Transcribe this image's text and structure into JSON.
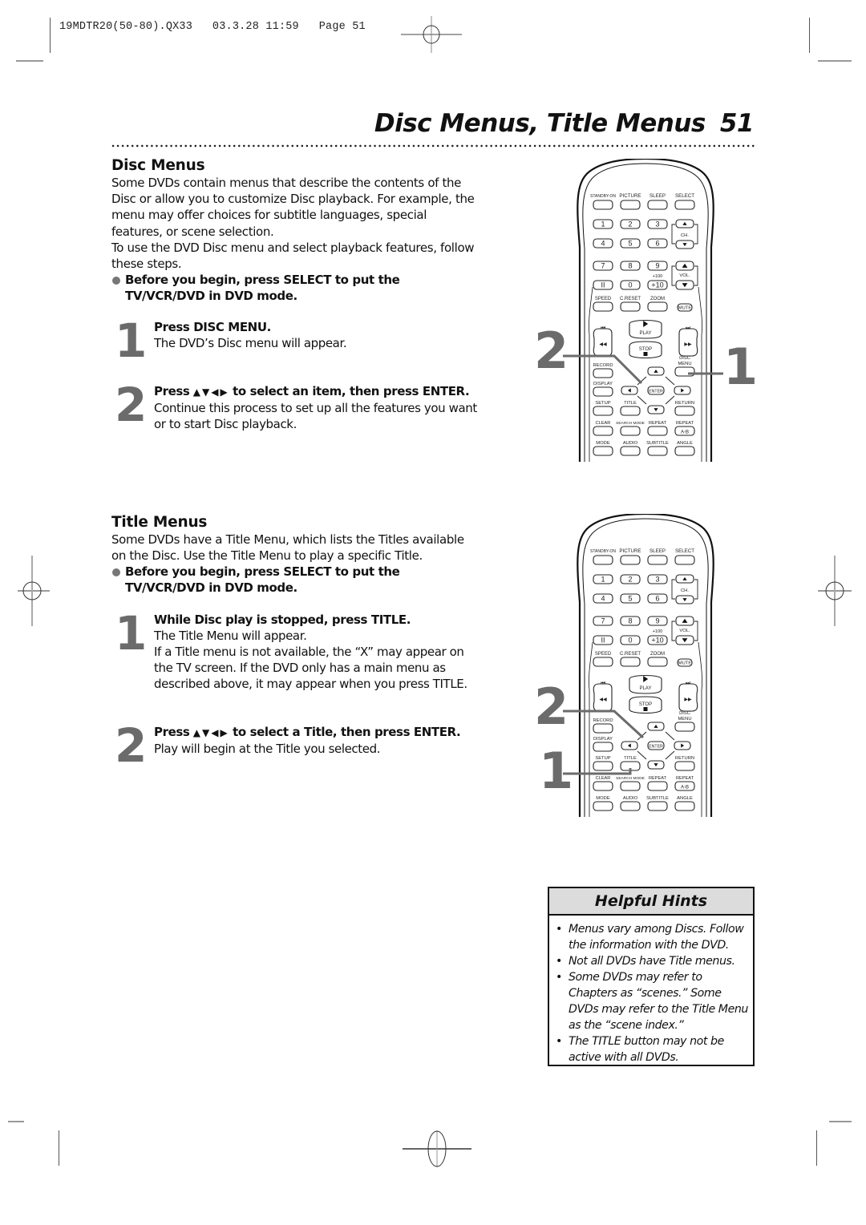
{
  "slug": "19MDTR20(50-80).QX33   03.3.28 11:59   Page 51",
  "header": {
    "title": "Disc Menus, Title Menus",
    "page_number": "51"
  },
  "disc_menus": {
    "heading": "Disc Menus",
    "intro": "Some DVDs contain menus that describe the contents of the Disc or allow you to customize Disc playback.  For example, the menu may offer choices for subtitle languages, special features, or scene selection.",
    "intro2": "To use the DVD Disc menu and select playback features, follow these steps.",
    "bullet": "Before you begin, press SELECT to put the TV/VCR/DVD in DVD mode.",
    "steps": [
      {
        "number": "1",
        "bold": "Press DISC MENU.",
        "text": "The DVD’s Disc menu will appear."
      },
      {
        "number": "2",
        "bold_pre": "Press",
        "arrows": "▲▼◀▶",
        "bold_post": "to select an item, then press ENTER.",
        "text": "Continue this process to set up all the features you want or to start Disc playback."
      }
    ]
  },
  "title_menus": {
    "heading": "Title Menus",
    "intro": "Some DVDs have a Title Menu, which lists the Titles available on the Disc.  Use the Title Menu to play a specific Title.",
    "bullet": "Before you begin, press SELECT to put the TV/VCR/DVD in DVD mode.",
    "steps": [
      {
        "number": "1",
        "bold": "While Disc play is stopped, press TITLE.",
        "text": "The Title Menu will appear.",
        "text2": "If a Title menu is not available, the “X” may appear on the TV screen. If the DVD only has a main menu as described above, it may appear when you press TITLE."
      },
      {
        "number": "2",
        "bold_pre": "Press",
        "arrows": "▲▼◀▶",
        "bold_post": "to select a Title, then press ENTER.",
        "text": "Play will begin at the Title you selected."
      }
    ]
  },
  "helpful_hints": {
    "heading": "Helpful Hints",
    "items": [
      "Menus vary among Discs. Follow the information with the DVD.",
      "Not all DVDs have Title menus.",
      "Some DVDs may refer to Chapters as “scenes.” Some DVDs may refer to the Title Menu as the “scene index.”",
      "The TITLE button may not be active with all DVDs."
    ]
  },
  "remote": {
    "top_labels": [
      "STANDBY-ON",
      "PICTURE",
      "SLEEP",
      "SELECT"
    ],
    "digits": [
      "1",
      "2",
      "3",
      "4",
      "5",
      "6",
      "7",
      "8",
      "9",
      "II",
      "0",
      "+10"
    ],
    "plus100": "+100",
    "ch_label": "CH.",
    "vol_label": "VOL.",
    "row_labels": [
      "SPEED",
      "C.RESET",
      "ZOOM"
    ],
    "mute": "MUTE",
    "play": "PLAY",
    "stop": "STOP",
    "record": "RECORD",
    "disc_menu": [
      "DISC",
      "MENU"
    ],
    "display": "DISPLAY",
    "enter": "ENTER",
    "setup": "SETUP",
    "title": "TITLE",
    "return": "RETURN",
    "row4": [
      "CLEAR",
      "SEARCH MODE",
      "REPEAT",
      "REPEAT"
    ],
    "ab": "A-B",
    "row5": [
      "MODE",
      "AUDIO",
      "SUBTITLE",
      "ANGLE"
    ]
  },
  "callouts": {
    "disc": {
      "left": "2",
      "right": "1"
    },
    "title": {
      "upper": "2",
      "lower": "1"
    }
  }
}
